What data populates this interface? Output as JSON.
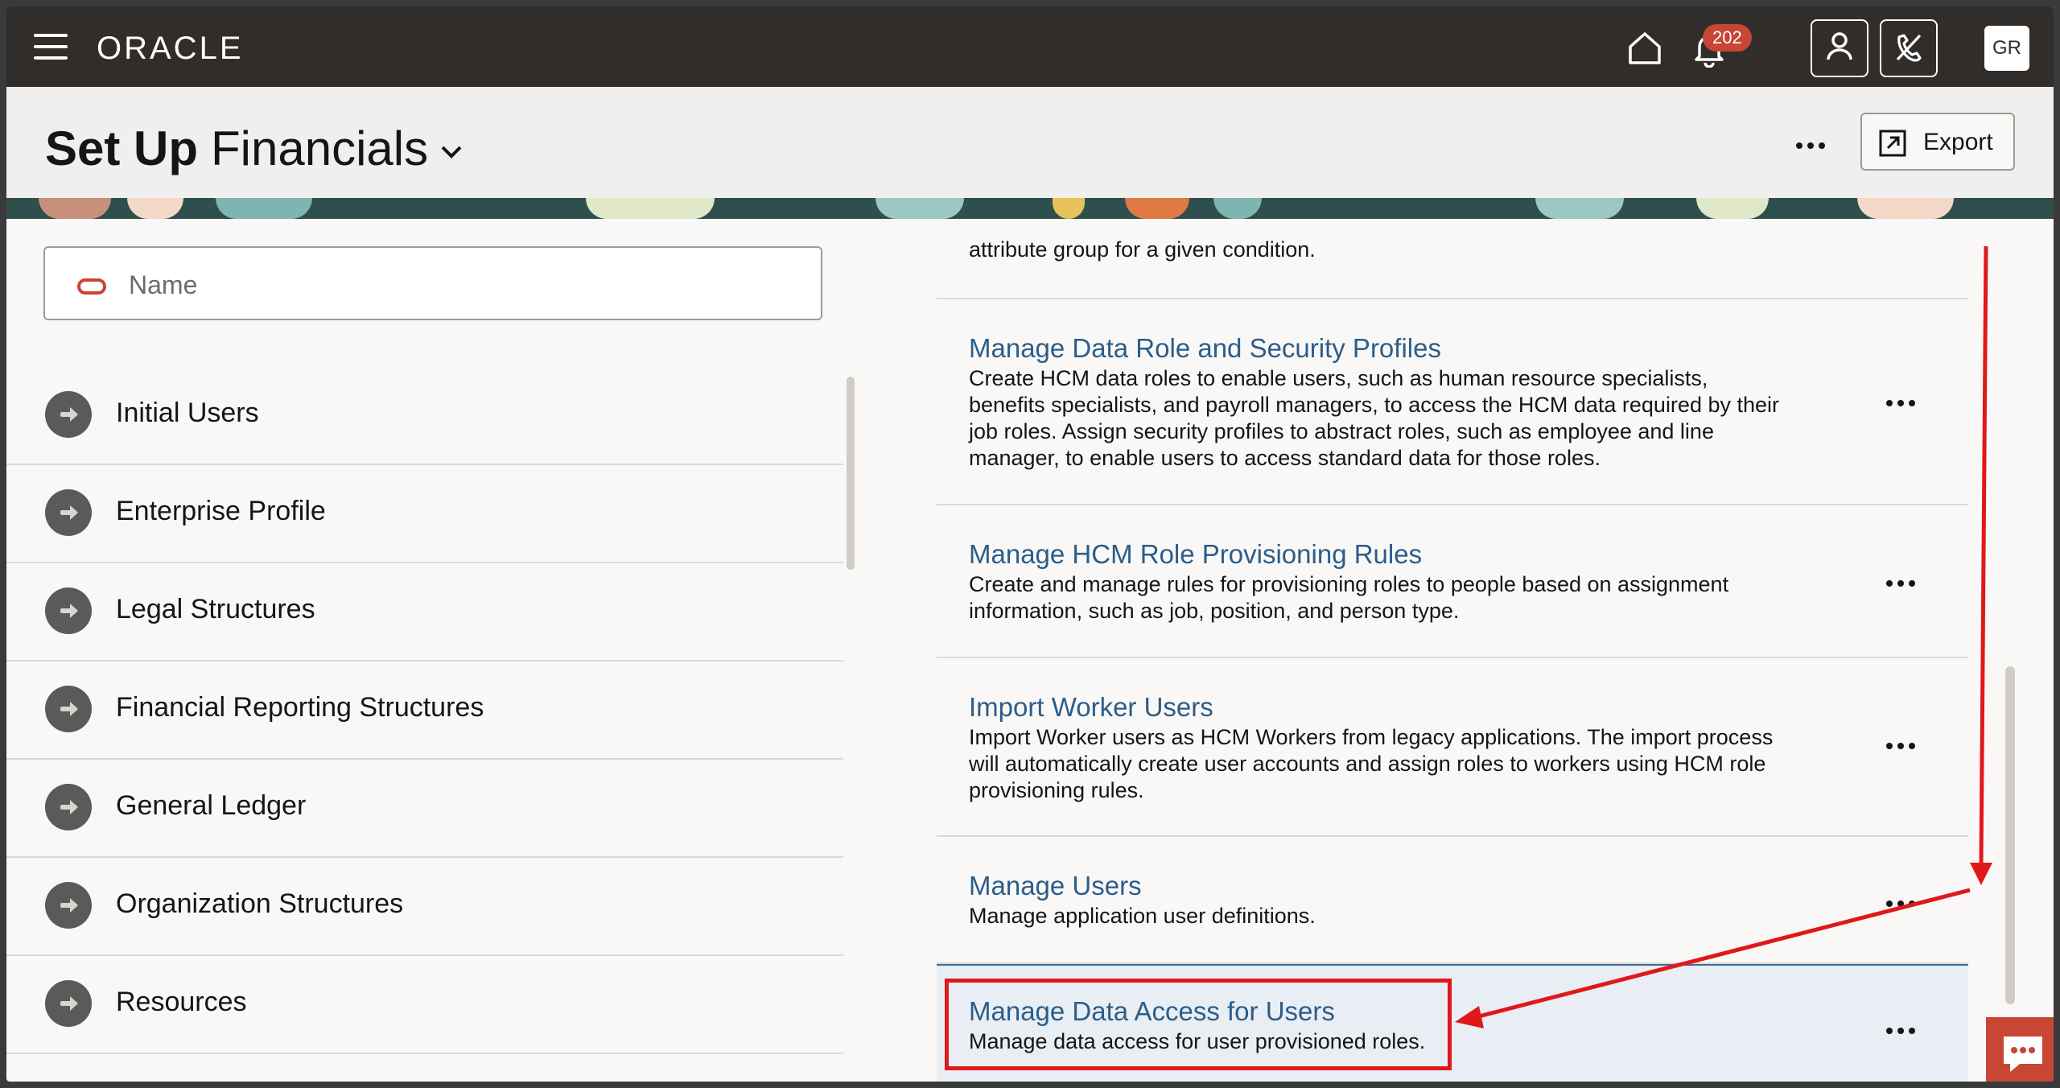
{
  "app": {
    "logo": "ORACLE",
    "notification_count": "202",
    "user_initials": "GR"
  },
  "header": {
    "title": "Set Up",
    "area": "Financials",
    "export_label": "Export"
  },
  "search": {
    "placeholder": "Name"
  },
  "sidebar": {
    "items": [
      {
        "label": "Initial Users"
      },
      {
        "label": "Enterprise Profile"
      },
      {
        "label": "Legal Structures"
      },
      {
        "label": "Financial Reporting Structures"
      },
      {
        "label": "General Ledger"
      },
      {
        "label": "Organization Structures"
      },
      {
        "label": "Resources"
      }
    ]
  },
  "tasks": {
    "partial_desc": "attribute group for a given condition.",
    "items": [
      {
        "title": "Manage Data Role and Security Profiles",
        "desc": "Create HCM data roles to enable users, such as human resource specialists, benefits specialists, and payroll managers, to access the HCM data required by their job roles. Assign security profiles to abstract roles, such as employee and line manager, to enable users to access standard data for those roles."
      },
      {
        "title": "Manage HCM Role Provisioning Rules",
        "desc": "Create and manage rules for provisioning roles to people based on assignment information, such as job, position, and person type."
      },
      {
        "title": "Import Worker Users",
        "desc": "Import Worker users as HCM Workers from legacy applications. The import process will automatically create user accounts and assign roles to workers using HCM role provisioning rules."
      },
      {
        "title": "Manage Users",
        "desc": "Manage application user definitions."
      },
      {
        "title": "Manage Data Access for Users",
        "desc": "Manage data access for user provisioned roles."
      }
    ]
  },
  "colors": {
    "topbar": "#312d2a",
    "link": "#2c5d8a",
    "accent": "#c74634",
    "highlight": "#e0181a",
    "selected_row": "#e8eef4"
  }
}
